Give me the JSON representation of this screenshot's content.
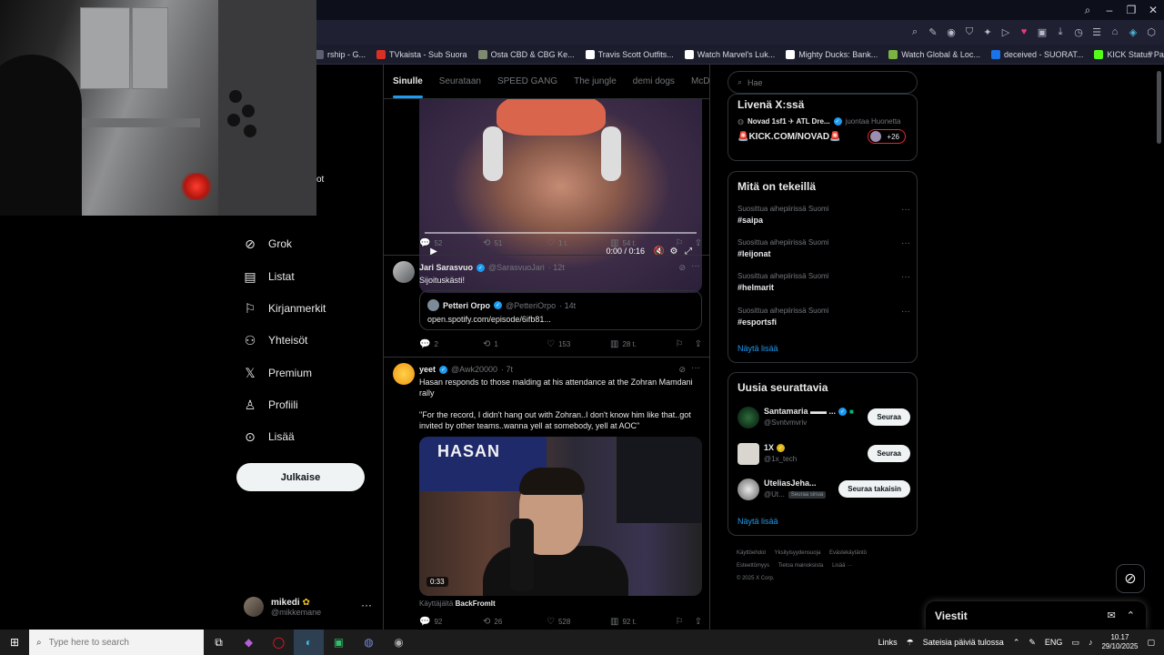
{
  "browser": {
    "bookmarks": [
      {
        "label": "rship - G...",
        "icon": "bookmark-icon",
        "color": "#5b5f70"
      },
      {
        "label": "TVkaista - Sub Suora",
        "icon": "tv-icon",
        "color": "#d93025"
      },
      {
        "label": "Osta CBD & CBG Ke...",
        "icon": "leaf-icon",
        "color": "#7d8a70"
      },
      {
        "label": "Travis Scott Outfits...",
        "icon": "shirt-icon",
        "color": "#ffffff"
      },
      {
        "label": "Watch Marvel's Luk...",
        "icon": "play-icon",
        "color": "#ffffff"
      },
      {
        "label": "Mighty Ducks: Bank...",
        "icon": "duck-icon",
        "color": "#ffffff"
      },
      {
        "label": "Watch Global & Loc...",
        "icon": "globe-icon",
        "color": "#7cb342"
      },
      {
        "label": "deceived - SUORAT...",
        "icon": "news-icon",
        "color": "#1a73e8"
      },
      {
        "label": "KICK Status Page",
        "icon": "kick-icon",
        "color": "#53fc18"
      }
    ]
  },
  "sidebar": {
    "partial_label": "ot",
    "items": [
      {
        "label": "Grok",
        "icon": "grok-icon"
      },
      {
        "label": "Listat",
        "icon": "list-icon"
      },
      {
        "label": "Kirjanmerkit",
        "icon": "bookmark-icon"
      },
      {
        "label": "Yhteisöt",
        "icon": "communities-icon"
      },
      {
        "label": "Premium",
        "icon": "x-logo-icon"
      },
      {
        "label": "Profiili",
        "icon": "profile-icon"
      },
      {
        "label": "Lisää",
        "icon": "more-circle-icon"
      }
    ],
    "post_button": "Julkaise",
    "account": {
      "name": "mikedi",
      "handle": "@mikkemane"
    }
  },
  "feed": {
    "tabs": [
      "Sinulle",
      "Seurataan",
      "SPEED GANG",
      "The jungle",
      "demi dogs",
      "McDonal"
    ],
    "active_tab": 0,
    "video1": {
      "time": "0:00 / 0:16"
    },
    "post1_actions": {
      "replies": "52",
      "reposts": "51",
      "likes": "1 t.",
      "views": "54 t."
    },
    "post2": {
      "name": "Jari Sarasvuo",
      "handle": "@SarasvuoJari",
      "time": "· 12t",
      "text": "Sijoituskästi!",
      "quote": {
        "name": "Petteri Orpo",
        "handle": "@PetteriOrpo",
        "time": "· 14t",
        "text": "open.spotify.com/episode/6ifb81..."
      },
      "actions": {
        "replies": "2",
        "reposts": "1",
        "likes": "153",
        "views": "28 t."
      }
    },
    "post3": {
      "name": "yeet",
      "handle": "@Awk20000",
      "time": "· 7t",
      "text1": "Hasan responds to those malding at his attendance at the Zohran Mamdani rally",
      "text2": "\"For the record, I didn't hang out with Zohran..I don't know him like that..got invited by other teams..wanna yell at somebody, yell at AOC\"",
      "video_poster": "HASAN",
      "video_time": "0:33",
      "attribution_prefix": "Käyttäjältä",
      "attribution_name": "BackFromIt",
      "actions": {
        "replies": "92",
        "reposts": "26",
        "likes": "528",
        "views": "92 t."
      }
    }
  },
  "right": {
    "search_placeholder": "Hae",
    "live": {
      "title": "Livenä X:ssä",
      "host": "Novad 1sf1 ✈ ATL Dre...",
      "host_suffix": "juontaa Huonetta",
      "room": "🚨KICK.COM/NOVAD🚨",
      "listeners": "+26"
    },
    "trends": {
      "title": "Mitä on tekeillä",
      "items": [
        {
          "context": "Suosittua aihepiirissä Suomi",
          "tag": "#saipa"
        },
        {
          "context": "Suosittua aihepiirissä Suomi",
          "tag": "#leijonat"
        },
        {
          "context": "Suosittua aihepiirissä Suomi",
          "tag": "#helmarit"
        },
        {
          "context": "Suosittua aihepiirissä Suomi",
          "tag": "#esportsfi"
        }
      ],
      "show_more": "Näytä lisää"
    },
    "who_to_follow": {
      "title": "Uusia seurattavia",
      "items": [
        {
          "name": "Santamaria ▬▬ ...",
          "handle": "@Svntvmvriv",
          "button": "Seuraa",
          "pill": ""
        },
        {
          "name": "1X",
          "handle": "@1x_tech",
          "button": "Seuraa",
          "pill": ""
        },
        {
          "name": "UteliasJeha...",
          "handle": "@Ut...",
          "button": "Seuraa takaisin",
          "pill": "Seuraa sinua"
        }
      ],
      "show_more": "Näytä lisää"
    },
    "footer": {
      "links": [
        "Käyttöehdot",
        "Yksityisyydensuoja",
        "Evästekäytäntö",
        "Esteettömyys",
        "Tietoa mainoksista",
        "Lisää ···"
      ],
      "copyright": "© 2025 X Corp."
    },
    "messages": "Viestit"
  },
  "taskbar": {
    "search_placeholder": "Type here to search",
    "links": "Links",
    "weather": "Sateisia päiviä tulossa",
    "lang": "ENG",
    "time": "10.17",
    "date": "29/10/2025"
  }
}
